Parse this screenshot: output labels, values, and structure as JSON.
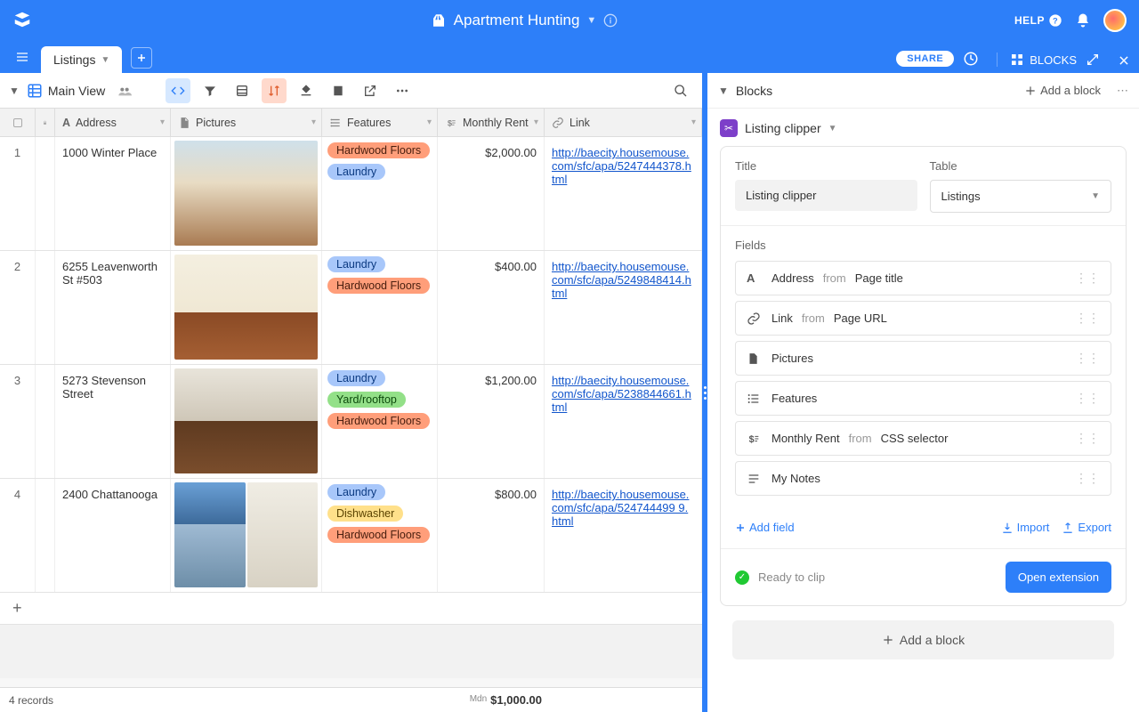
{
  "topbar": {
    "base_title": "Apartment Hunting",
    "help": "HELP"
  },
  "tabs": {
    "active": "Listings",
    "share": "SHARE",
    "blocks": "BLOCKS"
  },
  "toolbar": {
    "view_name": "Main View"
  },
  "columns": {
    "address": "Address",
    "pictures": "Pictures",
    "features": "Features",
    "rent": "Monthly Rent",
    "link": "Link"
  },
  "rows": [
    {
      "num": "1",
      "address": "1000 Winter Place",
      "thumbs": [
        "t1"
      ],
      "features": [
        "Hardwood Floors",
        "Laundry"
      ],
      "rent": "$2,000.00",
      "link": "http://baecity.housemouse.com/sfc/apa/5247444378.html"
    },
    {
      "num": "2",
      "address": "6255 Leavenworth St #503",
      "thumbs": [
        "t2"
      ],
      "features": [
        "Laundry",
        "Hardwood Floors"
      ],
      "rent": "$400.00",
      "link": "http://baecity.housemouse.com/sfc/apa/5249848414.html"
    },
    {
      "num": "3",
      "address": "5273 Stevenson Street",
      "thumbs": [
        "t3"
      ],
      "features": [
        "Laundry",
        "Yard/rooftop",
        "Hardwood Floors"
      ],
      "rent": "$1,200.00",
      "link": "http://baecity.housemouse.com/sfc/apa/5238844661.html"
    },
    {
      "num": "4",
      "address": "2400 Chattanooga",
      "thumbs": [
        "t4a",
        "t4b"
      ],
      "features": [
        "Laundry",
        "Dishwasher",
        "Hardwood Floors"
      ],
      "rent": "$800.00",
      "link": "http://baecity.housemouse.com/sfc/apa/524744499 9.html"
    }
  ],
  "footer": {
    "count": "4 records",
    "median_label": "Mdn",
    "median_value": "$1,000.00"
  },
  "blocks": {
    "title": "Blocks",
    "add": "Add a block",
    "chip": "Listing clipper",
    "title_label": "Title",
    "table_label": "Table",
    "title_value": "Listing clipper",
    "table_value": "Listings",
    "fields_label": "Fields",
    "fields": [
      {
        "icon": "A",
        "name": "Address",
        "from": "from",
        "source": "Page title"
      },
      {
        "icon": "link",
        "name": "Link",
        "from": "from",
        "source": "Page URL"
      },
      {
        "icon": "file",
        "name": "Pictures",
        "from": "",
        "source": ""
      },
      {
        "icon": "list",
        "name": "Features",
        "from": "",
        "source": ""
      },
      {
        "icon": "currency",
        "name": "Monthly Rent",
        "from": "from",
        "source": "CSS selector"
      },
      {
        "icon": "text",
        "name": "My Notes",
        "from": "",
        "source": ""
      }
    ],
    "add_field": "Add field",
    "import": "Import",
    "export": "Export",
    "ready": "Ready to clip",
    "open_ext": "Open extension",
    "add_block_big": "Add a block"
  },
  "tag_classes": {
    "Hardwood Floors": "hardwood",
    "Laundry": "laundry",
    "Yard/rooftop": "yard",
    "Dishwasher": "dish"
  }
}
